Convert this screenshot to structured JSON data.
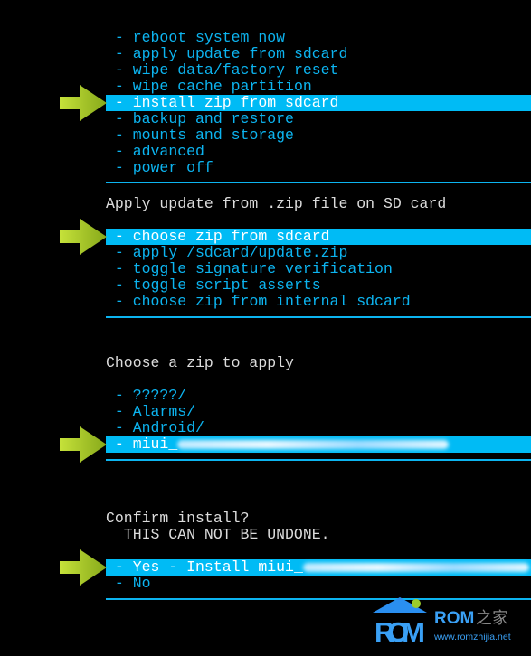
{
  "main_menu": {
    "items": [
      "reboot system now",
      "apply update from sdcard",
      "wipe data/factory reset",
      "wipe cache partition",
      "install zip from sdcard",
      "backup and restore",
      "mounts and storage",
      "advanced",
      "power off"
    ],
    "selected": 4
  },
  "apply_menu": {
    "heading": "Apply update from .zip file on SD card",
    "items": [
      "choose zip from sdcard",
      "apply /sdcard/update.zip",
      "toggle signature verification",
      "toggle script asserts",
      "choose zip from internal sdcard"
    ],
    "selected": 0
  },
  "choose_menu": {
    "heading": "Choose a zip to apply",
    "items": [
      "?????/",
      "Alarms/",
      "Android/",
      "miui_"
    ],
    "selected": 3
  },
  "confirm_menu": {
    "heading": "Confirm install?",
    "warning": "  THIS CAN NOT BE UNDONE.",
    "items": [
      "Yes - Install miui_",
      "No"
    ],
    "selected": 0
  },
  "watermark": {
    "brand": "ROM",
    "brand_cn": "ROM之家",
    "url": "www.romzhijia.net"
  },
  "colors": {
    "menu_text": "#0cb4f0",
    "highlight": "#00bbf5",
    "heading": "#dcdcdc",
    "arrow": "#a8cc2a"
  }
}
